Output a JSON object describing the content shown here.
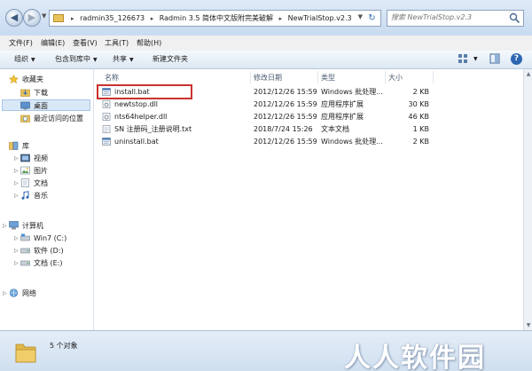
{
  "address": {
    "crumbs": [
      "radmin35_126673",
      "Radmin 3.5 简体中文版附完美破解",
      "NewTrialStop.v2.3"
    ],
    "search_placeholder": "搜索 NewTrialStop.v2.3"
  },
  "menu": [
    "文件(F)",
    "编辑(E)",
    "查看(V)",
    "工具(T)",
    "帮助(H)"
  ],
  "toolbar": {
    "organize": "组织",
    "include": "包含到库中",
    "share": "共享",
    "new_folder": "新建文件夹"
  },
  "nav": {
    "favorites": "收藏夹",
    "downloads": "下载",
    "desktop": "桌面",
    "recent": "最近访问的位置",
    "libraries": "库",
    "videos": "视频",
    "pictures": "图片",
    "documents": "文档",
    "music": "音乐",
    "computer": "计算机",
    "drive_c": "Win7 (C:)",
    "drive_d": "软件 (D:)",
    "drive_e": "文档 (E:)",
    "network": "网络"
  },
  "columns": {
    "name": "名称",
    "modified": "修改日期",
    "type": "类型",
    "size": "大小"
  },
  "files": [
    {
      "name": "install.bat",
      "modified": "2012/12/26 15:59",
      "type": "Windows 批处理...",
      "size": "2 KB",
      "icon": "bat-file-icon"
    },
    {
      "name": "newtstop.dll",
      "modified": "2012/12/26 15:59",
      "type": "应用程序扩展",
      "size": "30 KB",
      "icon": "dll-file-icon"
    },
    {
      "name": "nts64helper.dll",
      "modified": "2012/12/26 15:59",
      "type": "应用程序扩展",
      "size": "46 KB",
      "icon": "dll-file-icon"
    },
    {
      "name": "SN 注册码_注册说明.txt",
      "modified": "2018/7/24 15:26",
      "type": "文本文档",
      "size": "1 KB",
      "icon": "txt-file-icon"
    },
    {
      "name": "uninstall.bat",
      "modified": "2012/12/26 15:59",
      "type": "Windows 批处理...",
      "size": "2 KB",
      "icon": "bat-file-icon"
    }
  ],
  "status": {
    "count": "5 个对象"
  },
  "watermark": "人人软件园",
  "colors": {
    "highlight_box": "#c9322e",
    "selection": "#d9e8f7",
    "chrome": "#cfe0f3"
  }
}
